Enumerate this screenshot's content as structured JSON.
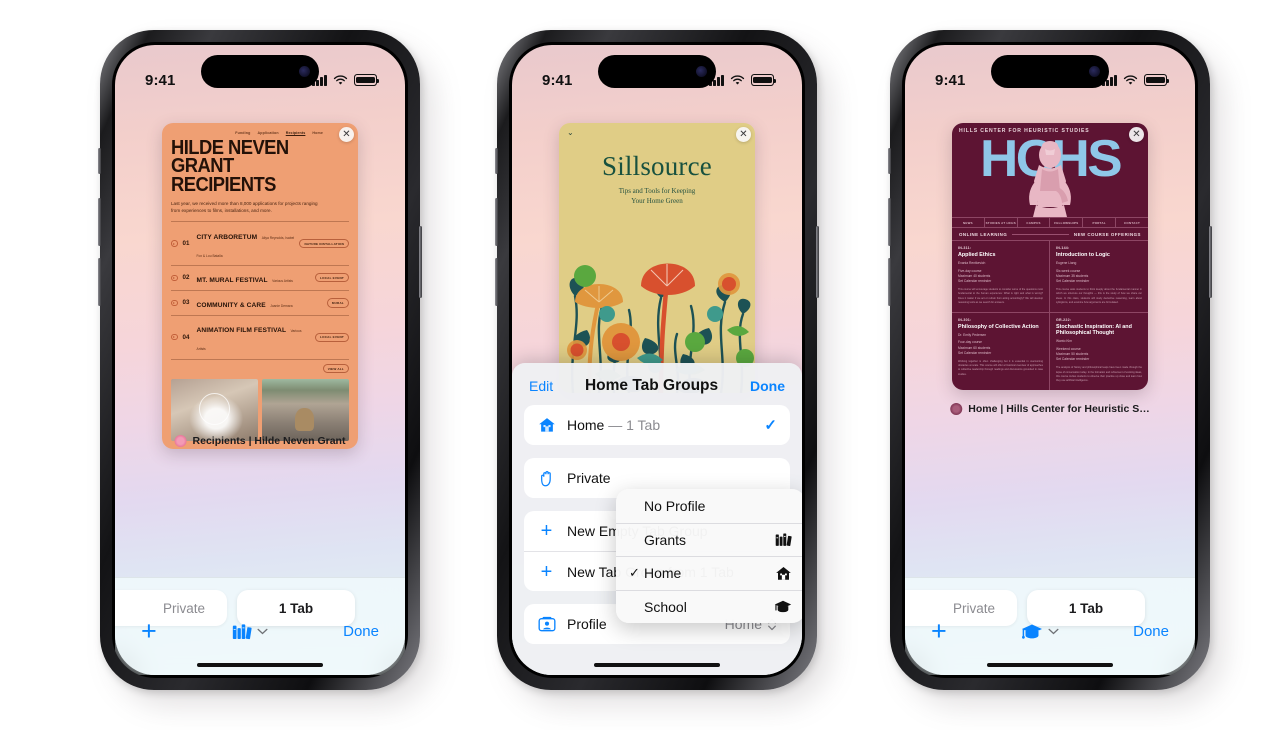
{
  "status_bar": {
    "time": "9:41",
    "signal": "cellular-bars-icon",
    "wifi": "wifi-icon",
    "battery": "battery-icon"
  },
  "phones": [
    {
      "id": "phone-grants",
      "tab_label": "Recipients | Hilde Neven Grant",
      "toolbar": {
        "private_pill": "Private",
        "tabs_pill": "1 Tab",
        "add_label": "+",
        "done_label": "Done",
        "profile_icon": "books-icon"
      },
      "page": {
        "nav": [
          "Funding",
          "Application",
          "Recipients",
          "Home"
        ],
        "heading_line1": "HILDE NEVEN",
        "heading_line2": "GRANT RECIPIENTS",
        "intro": "Last year, we received more than 8,000 applications for projects ranging from experiences to films, installations, and more.",
        "view_all": "VIEW ALL",
        "items": [
          {
            "num": "01",
            "name": "CITY ARBORETUM",
            "by": "Aliya Reynolds, Isabel Fox & Lou Batalla",
            "tag": "NATURE INSTALLATION"
          },
          {
            "num": "02",
            "name": "MT. MURAL FESTIVAL",
            "by": "Various Artists",
            "tag": "LOCAL EVENT"
          },
          {
            "num": "03",
            "name": "COMMUNITY & CARE",
            "by": "Joanie Demara",
            "tag": "MURAL"
          },
          {
            "num": "04",
            "name": "ANIMATION FILM FESTIVAL",
            "by": "Various Artists",
            "tag": "LOCAL EVENT"
          }
        ]
      }
    },
    {
      "id": "phone-home",
      "page": {
        "title": "Sillsource",
        "tagline_line1": "Tips and Tools for Keeping",
        "tagline_line2": "Your Home Green"
      },
      "sheet": {
        "edit_label": "Edit",
        "title": "Home Tab Groups",
        "done_label": "Done",
        "rows": [
          {
            "icon": "house-icon",
            "label": "Home",
            "suffix": " — 1 Tab",
            "trailing": "checkmark-icon"
          },
          {
            "icon": "raised-hand-icon",
            "label": "Private",
            "suffix": "",
            "trailing": ""
          },
          {
            "icon": "plus-icon",
            "label": "New Empty Tab Group",
            "suffix": "",
            "trailing": ""
          },
          {
            "icon": "plus-icon",
            "label": "New Tab Group from 1 Tab",
            "suffix": "",
            "trailing": ""
          }
        ],
        "profile_row": {
          "icon": "profile-card-icon",
          "label": "Profile",
          "value": "Home",
          "chevron": "chevron-up-down-icon"
        }
      },
      "popup": {
        "options": [
          {
            "label": "No Profile",
            "checked": false,
            "icon": ""
          },
          {
            "label": "Grants",
            "checked": false,
            "icon": "books-icon"
          },
          {
            "label": "Home",
            "checked": true,
            "icon": "house-icon"
          },
          {
            "label": "School",
            "checked": false,
            "icon": "graduation-cap-icon"
          }
        ]
      }
    },
    {
      "id": "phone-school",
      "tab_label": "Home | Hills Center for Heuristic S…",
      "toolbar": {
        "private_pill": "Private",
        "tabs_pill": "1 Tab",
        "add_label": "+",
        "done_label": "Done",
        "profile_icon": "graduation-cap-icon"
      },
      "page": {
        "kicker": "HILLS CENTER FOR HEURISTIC STUDIES",
        "logo": "HCHS",
        "nav": [
          "NEWS",
          "STUDIES AT HCHS",
          "CAMPUS",
          "FELLOWSHIPS",
          "PORTAL",
          "CONTACT"
        ],
        "section_left": "ONLINE LEARNING",
        "section_right": "NEW COURSE OFFERINGS",
        "courses": [
          {
            "code": "IN-311:",
            "title": "Applied Ethics",
            "instructor": "Evania Rentkevich",
            "meta": "Five-day course\nMaximum 40 students\nSet Calendar reminder",
            "body": "This course will encourage students to consider some of the questions most fundamental to the human experience: What is right and what is wrong? Does it matter if we act or refrain from acting accordingly? We will develop reasoning tools as we search for answers."
          },
          {
            "code": "IN-144:",
            "title": "Introduction to Logic",
            "instructor": "Eugene Liang",
            "meta": "Six-week course\nMaximum 35 students\nSet Calendar reminder",
            "body": "This course asks students to think deeply about the fundamental manner in which we structure our thoughts — this is the study of how we share our ideas. In this class, students will study deductive reasoning, learn about syllogisms, and examine how arguments are formulated."
          },
          {
            "code": "IN-301:",
            "title": "Philosophy of Collective Action",
            "instructor": "Dr. Emily Pedersen",
            "meta": "Four-day course\nMaximum 60 students\nSet Calendar reminder",
            "body": "Working together is often challenging but it is essential in overcoming obstacles at scale. This course will offer a historical overview of approaches to collective leadership through readings and discussions grounded in case studies."
          },
          {
            "code": "GR-222:",
            "title": "Stochastic Inspiration: AI and Philosophical Thought",
            "instructor": "Wanto Kim",
            "meta": "Weekend course\nMaximum 50 students\nSet Calendar reminder",
            "body": "The analysis of history and philosophical leaps have been made through the lapse of conversation today. In the formation and refinement of existing ideas, this course invites students to observe their practice up close and learn how they use artificial intelligence."
          }
        ]
      }
    }
  ],
  "colors": {
    "accent_blue": "#0a84ff",
    "grants_bg": "#ef9f73",
    "home_bg": "#e0cd86",
    "school_bg": "#5d1433",
    "school_logo": "#8fc7e8"
  }
}
